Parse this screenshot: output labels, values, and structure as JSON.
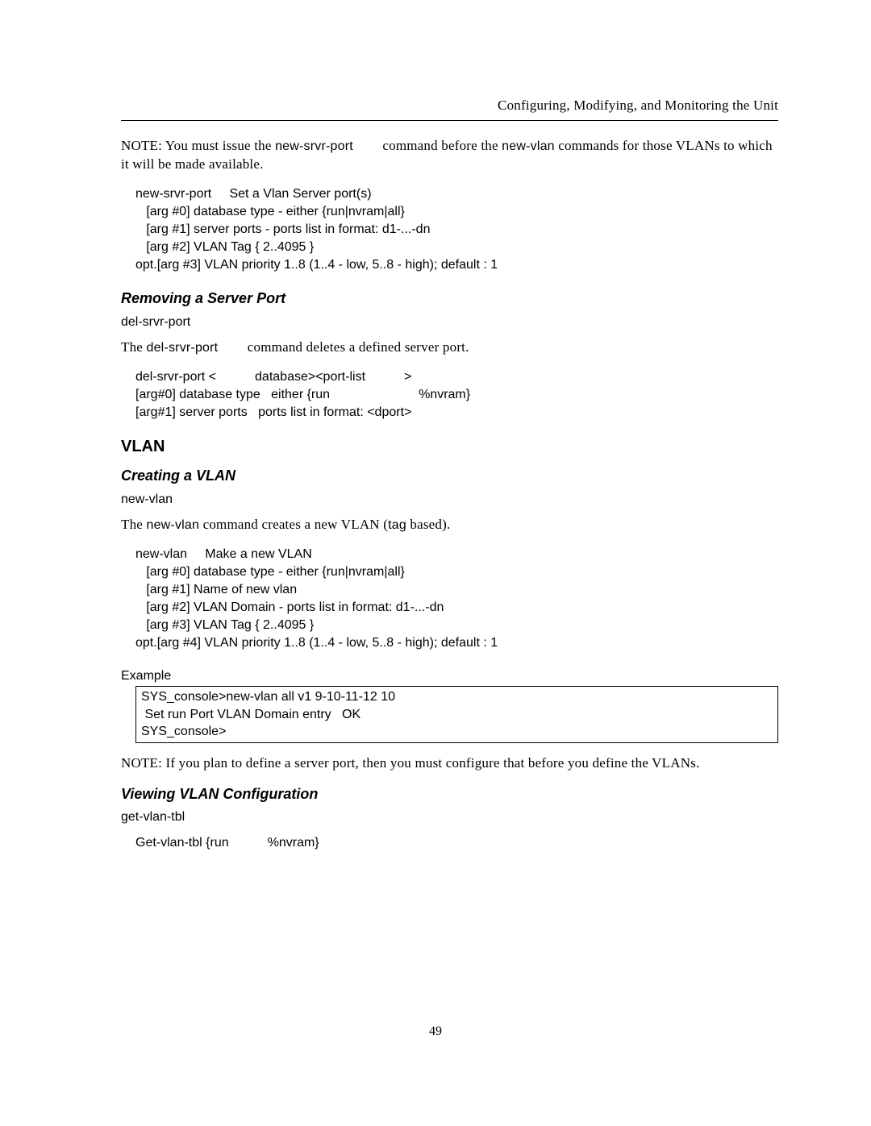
{
  "header": {
    "running_title": "Configuring, Modifying, and Monitoring the Unit"
  },
  "note1": {
    "prefix": "NOTE:  You must issue the ",
    "cmd1": "new-srvr-port",
    "mid1": " command before the ",
    "cmd2": "new-vlan",
    "mid2": " commands for those VLANs to which it will be made available."
  },
  "code1": "new-srvr-port     Set a Vlan Server port(s)\n   [arg #0] database type - either {run|nvram|all}\n   [arg #1] server ports - ports list in format: d1-...-dn\n   [arg #2] VLAN Tag { 2..4095 }\nopt.[arg #3] VLAN priority 1..8 (1..4 - low, 5..8 - high); default : 1",
  "removing": {
    "heading": "Removing a Server Port",
    "cmd_name": "del-srvr-port",
    "desc_pre": "The ",
    "desc_cmd": "del-srvr-port",
    "desc_post": " command deletes a defined server port."
  },
  "code2_l1a": "del-srvr-port <",
  "code2_l1b": "database><port-list",
  "code2_l1c": ">",
  "code2_l2a": "[arg#0] database type   either {run",
  "code2_l2b": "%nvram}",
  "code2_l3": "[arg#1] server ports   ports list in format: <dport>",
  "vlan": {
    "heading": "VLAN",
    "creating": "Creating a VLAN",
    "cmd_name": "new-vlan",
    "desc_pre": "The ",
    "desc_cmd": "new-vlan",
    "desc_mid": " command creates a new VLAN (",
    "desc_tag": "tag",
    "desc_post": " based)."
  },
  "code3": "new-vlan     Make a new VLAN\n   [arg #0] database type - either {run|nvram|all}\n   [arg #1] Name of new vlan\n   [arg #2] VLAN Domain - ports list in format: d1-...-dn\n   [arg #3] VLAN Tag { 2..4095 }\nopt.[arg #4] VLAN priority 1..8 (1..4 - low, 5..8 - high); default : 1",
  "example_label": "Example",
  "example_box": "SYS_console>new-vlan all v1 9-10-11-12 10\n Set run Port VLAN Domain entry   OK\nSYS_console>",
  "note2": "NOTE: If you plan to define a server port, then you must configure that before you define the VLANs.",
  "viewing": {
    "heading": "Viewing VLAN Configuration",
    "cmd_name": "get-vlan-tbl"
  },
  "code4_a": "Get-vlan-tbl {run",
  "code4_b": "%nvram}",
  "page_number": "49"
}
